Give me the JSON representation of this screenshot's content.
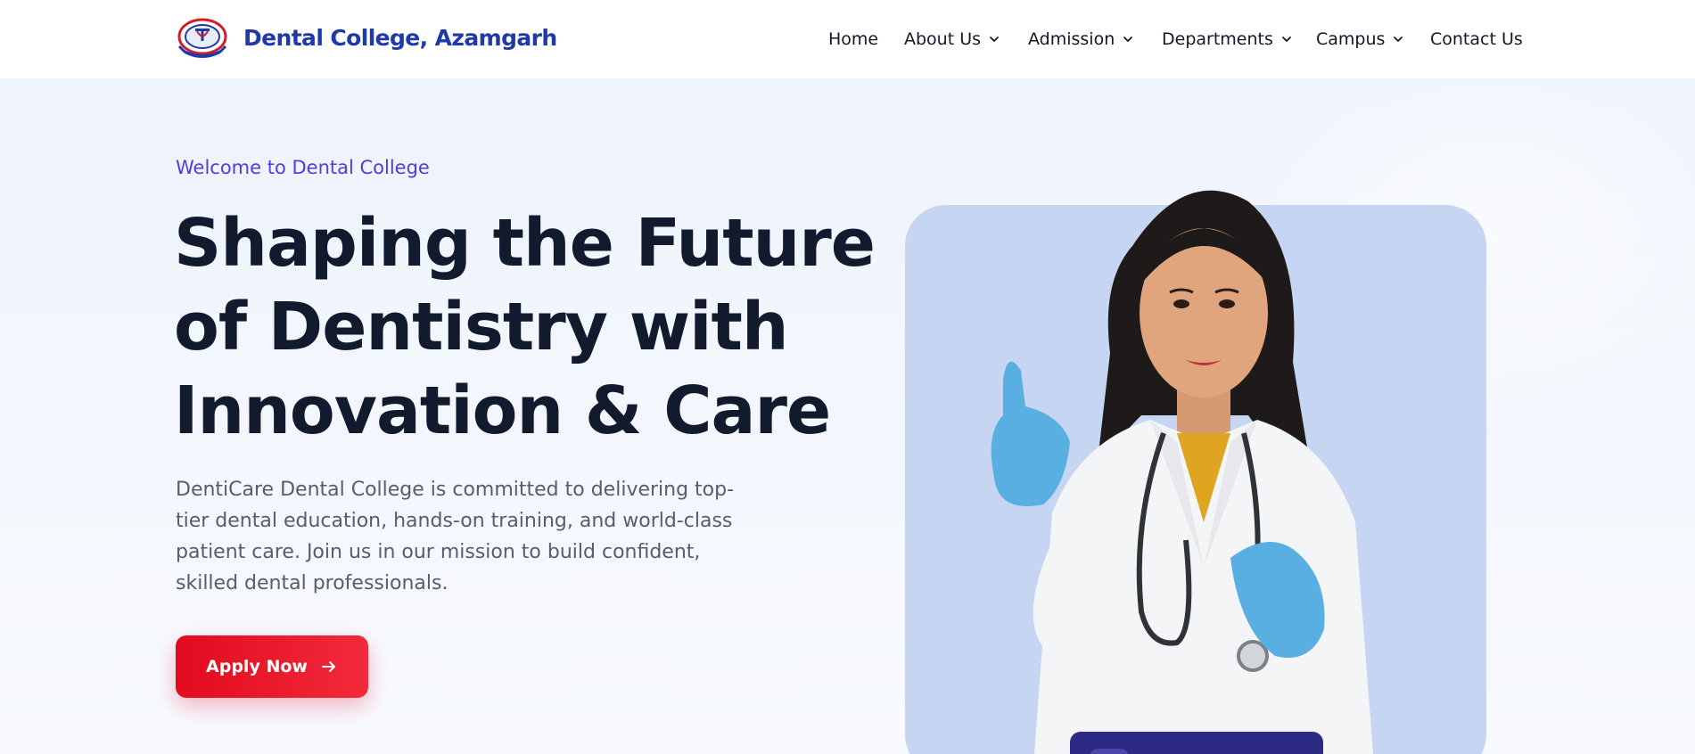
{
  "header": {
    "brand": "Dental College, Azamgarh",
    "nav": [
      {
        "label": "Home",
        "has_dropdown": false
      },
      {
        "label": "About Us",
        "has_dropdown": true
      },
      {
        "label": "Admission",
        "has_dropdown": true
      },
      {
        "label": "Departments",
        "has_dropdown": true
      },
      {
        "label": "Campus",
        "has_dropdown": true
      },
      {
        "label": "Contact Us",
        "has_dropdown": false
      }
    ]
  },
  "hero": {
    "eyebrow": "Welcome to Dental College",
    "headline_lines": [
      "Shaping the Future",
      "of Dentistry with",
      "Innovation & Care"
    ],
    "description": "DentiCare Dental College is committed to delivering top-tier dental education, hands-on training, and world-class patient care. Join us in our mission to build confident, skilled dental professionals.",
    "cta_label": "Apply Now"
  },
  "colors": {
    "brand_blue": "#1f3aa8",
    "accent_purple": "#4b3fe0",
    "cta_red": "#e20a1e",
    "headline": "#121a2e",
    "card_bg": "#c6d6f2"
  },
  "icons": {
    "logo": "college-emblem-icon",
    "dropdown": "chevron-down-icon",
    "cta": "arrow-right-icon"
  }
}
